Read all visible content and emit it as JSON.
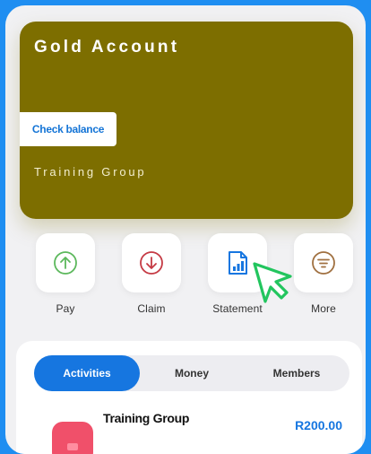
{
  "account_card": {
    "title": "Gold Account",
    "check_balance_label": "Check balance",
    "group_name": "Training Group",
    "color": "#7d6e00"
  },
  "actions": [
    {
      "label": "Pay",
      "icon": "arrow-up-circle-icon",
      "color": "#5cb85c"
    },
    {
      "label": "Claim",
      "icon": "arrow-down-circle-icon",
      "color": "#c53a44"
    },
    {
      "label": "Statement",
      "icon": "document-chart-icon",
      "color": "#1676e0"
    },
    {
      "label": "More",
      "icon": "filter-circle-icon",
      "color": "#a07040"
    }
  ],
  "tabs": [
    {
      "label": "Activities",
      "active": true
    },
    {
      "label": "Money",
      "active": false
    },
    {
      "label": "Members",
      "active": false
    }
  ],
  "activity": {
    "name": "Training Group",
    "amount": "R200.00"
  },
  "colors": {
    "background": "#1f8ef1",
    "accent": "#1676e0",
    "cursor": "#22c55e"
  }
}
